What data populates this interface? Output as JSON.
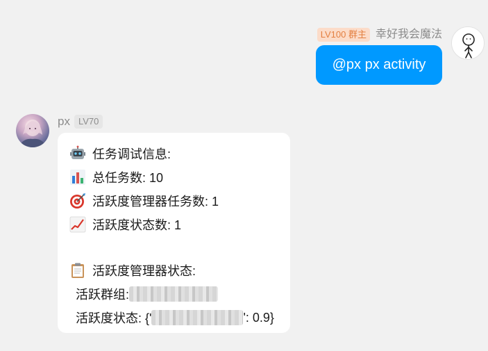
{
  "outgoing": {
    "badge": "LV100 群主",
    "sender": "幸好我会魔法",
    "message": "@px px activity",
    "avatar_icon": "stick-figure-avatar-icon"
  },
  "incoming": {
    "sender": "px",
    "badge": "LV70",
    "avatar_icon": "anime-girl-avatar-icon",
    "lines": {
      "debug_title": "任务调试信息:",
      "total_tasks": "总任务数: 10",
      "manager_tasks": "活跃度管理器任务数: 1",
      "status_count": "活跃度状态数: 1",
      "manager_status": "活跃度管理器状态:",
      "active_groups_label": "活跃群组: ",
      "active_status_prefix": "活跃度状态: {'",
      "active_status_suffix": "': 0.9}"
    },
    "icons": [
      "robot-icon",
      "bar-chart-icon",
      "target-icon",
      "trend-up-icon",
      "clipboard-icon"
    ]
  }
}
